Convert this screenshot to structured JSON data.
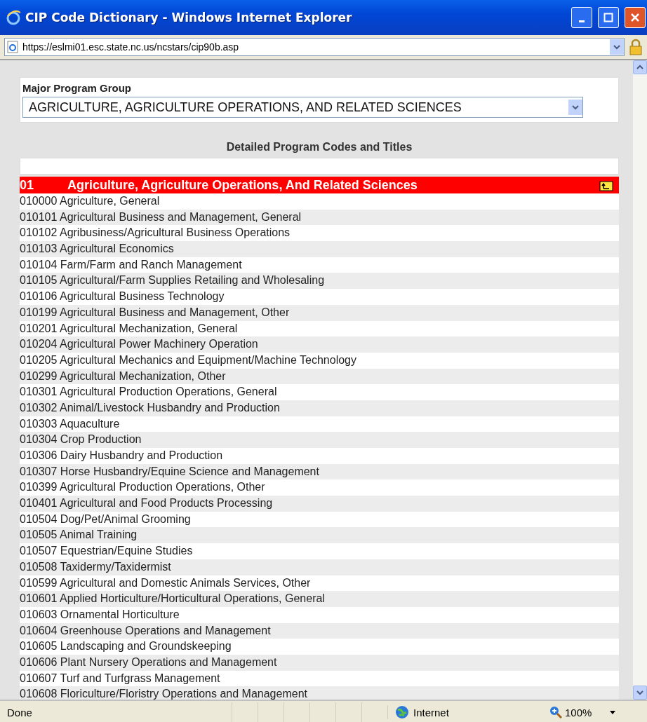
{
  "window": {
    "title": "CIP Code Dictionary - Windows Internet Explorer"
  },
  "address_bar": {
    "url": "https://eslmi01.esc.state.nc.us/ncstars/cip90b.asp"
  },
  "filter": {
    "label": "Major Program Group",
    "value": "AGRICULTURE, AGRICULTURE OPERATIONS, AND RELATED SCIENCES"
  },
  "list": {
    "heading": "Detailed Program Codes and Titles",
    "group": {
      "code": "01",
      "title": "Agriculture, Agriculture Operations, And Related Sciences"
    },
    "rows": [
      "010000 Agriculture, General",
      "010101 Agricultural Business and Management, General",
      "010102 Agribusiness/Agricultural Business Operations",
      "010103 Agricultural Economics",
      "010104 Farm/Farm and Ranch Management",
      "010105 Agricultural/Farm Supplies Retailing and Wholesaling",
      "010106 Agricultural Business Technology",
      "010199 Agricultural Business and Management, Other",
      "010201 Agricultural Mechanization, General",
      "010204 Agricultural Power Machinery Operation",
      "010205 Agricultural Mechanics and Equipment/Machine Technology",
      "010299 Agricultural Mechanization, Other",
      "010301 Agricultural Production Operations, General",
      "010302 Animal/Livestock Husbandry and Production",
      "010303 Aquaculture",
      "010304 Crop Production",
      "010306 Dairy Husbandry and Production",
      "010307 Horse Husbandry/Equine Science and Management",
      "010399 Agricultural Production Operations, Other",
      "010401 Agricultural and Food Products Processing",
      "010504 Dog/Pet/Animal Grooming",
      "010505 Animal Training",
      "010507 Equestrian/Equine Studies",
      "010508 Taxidermy/Taxidermist",
      "010599 Agricultural and Domestic Animals Services, Other",
      "010601 Applied Horticulture/Horticultural Operations, General",
      "010603 Ornamental Horticulture",
      "010604 Greenhouse Operations and Management",
      "010605 Landscaping and Groundskeeping",
      "010606 Plant Nursery Operations and Management",
      "010607 Turf and Turfgrass Management",
      "010608 Floriculture/Floristry Operations and Management"
    ]
  },
  "status_bar": {
    "status": "Done",
    "zone": "Internet",
    "zoom": "100%"
  }
}
